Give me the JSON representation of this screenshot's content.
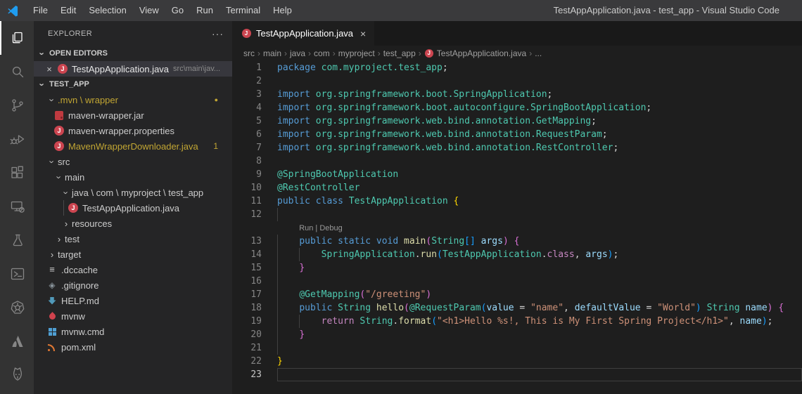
{
  "window": {
    "title": "TestAppApplication.java - test_app - Visual Studio Code",
    "menus": [
      "File",
      "Edit",
      "Selection",
      "View",
      "Go",
      "Run",
      "Terminal",
      "Help"
    ]
  },
  "activity_bar": {
    "items": [
      {
        "name": "explorer",
        "active": true
      },
      {
        "name": "search",
        "active": false
      },
      {
        "name": "source-control",
        "active": false
      },
      {
        "name": "run-and-debug",
        "active": false
      },
      {
        "name": "extensions",
        "active": false
      },
      {
        "name": "remote-explorer",
        "active": false
      },
      {
        "name": "testing",
        "active": false
      },
      {
        "name": "powershell",
        "active": false
      },
      {
        "name": "kubernetes",
        "active": false
      },
      {
        "name": "atlassian",
        "active": false
      },
      {
        "name": "snyk",
        "active": false
      }
    ]
  },
  "sidebar": {
    "title": "EXPLORER",
    "more_label": "···",
    "open_editors": {
      "label": "OPEN EDITORS",
      "items": [
        {
          "label": "TestAppApplication.java",
          "path": "src\\main\\jav...",
          "icon": "java",
          "close_glyph": "×",
          "selected": true
        }
      ]
    },
    "tree": {
      "label": "TEST_APP",
      "items": [
        {
          "label": ".mvn \\ wrapper",
          "indent": 1,
          "chevron": "down",
          "warn": true,
          "dot": "●"
        },
        {
          "label": "maven-wrapper.jar",
          "indent": 2,
          "icon": "jar"
        },
        {
          "label": "maven-wrapper.properties",
          "indent": 2,
          "icon": "java"
        },
        {
          "label": "MavenWrapperDownloader.java",
          "indent": 2,
          "icon": "java",
          "warn": true,
          "badge": "1"
        },
        {
          "label": "src",
          "indent": 1,
          "chevron": "down"
        },
        {
          "label": "main",
          "indent": 2,
          "chevron": "down"
        },
        {
          "label": "java \\ com \\ myproject \\ test_app",
          "indent": 3,
          "chevron": "down"
        },
        {
          "label": "TestAppApplication.java",
          "indent": 4,
          "icon": "java",
          "guide": true
        },
        {
          "label": "resources",
          "indent": 3,
          "chevron": "right"
        },
        {
          "label": "test",
          "indent": 2,
          "chevron": "right"
        },
        {
          "label": "target",
          "indent": 1,
          "chevron": "right"
        },
        {
          "label": ".dccache",
          "indent": 1,
          "icon": "dccache"
        },
        {
          "label": ".gitignore",
          "indent": 1,
          "icon": "git"
        },
        {
          "label": "HELP.md",
          "indent": 1,
          "icon": "md"
        },
        {
          "label": "mvnw",
          "indent": 1,
          "icon": "mvnw"
        },
        {
          "label": "mvnw.cmd",
          "indent": 1,
          "icon": "cmd"
        },
        {
          "label": "pom.xml",
          "indent": 1,
          "icon": "xml"
        }
      ]
    }
  },
  "editor": {
    "tab": {
      "label": "TestAppApplication.java",
      "icon": "java",
      "close_glyph": "×"
    },
    "breadcrumbs": [
      {
        "label": "src"
      },
      {
        "label": "main"
      },
      {
        "label": "java"
      },
      {
        "label": "com"
      },
      {
        "label": "myproject"
      },
      {
        "label": "test_app"
      },
      {
        "label": "TestAppApplication.java",
        "icon": "java"
      },
      {
        "label": "..."
      }
    ],
    "code": {
      "lines": [
        {
          "n": 1,
          "indent": 0,
          "guides": [],
          "tokens": [
            [
              "kw",
              "package"
            ],
            [
              "pl",
              " "
            ],
            [
              "ty",
              "com.myproject.test_app"
            ],
            [
              "pl",
              ";"
            ]
          ]
        },
        {
          "n": 2,
          "indent": 0,
          "guides": [],
          "tokens": []
        },
        {
          "n": 3,
          "indent": 0,
          "guides": [],
          "tokens": [
            [
              "kw",
              "import"
            ],
            [
              "pl",
              " "
            ],
            [
              "ty",
              "org.springframework.boot.SpringApplication"
            ],
            [
              "pl",
              ";"
            ]
          ]
        },
        {
          "n": 4,
          "indent": 0,
          "guides": [],
          "tokens": [
            [
              "kw",
              "import"
            ],
            [
              "pl",
              " "
            ],
            [
              "ty",
              "org.springframework.boot.autoconfigure.SpringBootApplication"
            ],
            [
              "pl",
              ";"
            ]
          ]
        },
        {
          "n": 5,
          "indent": 0,
          "guides": [],
          "tokens": [
            [
              "kw",
              "import"
            ],
            [
              "pl",
              " "
            ],
            [
              "ty",
              "org.springframework.web.bind.annotation.GetMapping"
            ],
            [
              "pl",
              ";"
            ]
          ]
        },
        {
          "n": 6,
          "indent": 0,
          "guides": [],
          "tokens": [
            [
              "kw",
              "import"
            ],
            [
              "pl",
              " "
            ],
            [
              "ty",
              "org.springframework.web.bind.annotation.RequestParam"
            ],
            [
              "pl",
              ";"
            ]
          ]
        },
        {
          "n": 7,
          "indent": 0,
          "guides": [],
          "tokens": [
            [
              "kw",
              "import"
            ],
            [
              "pl",
              " "
            ],
            [
              "ty",
              "org.springframework.web.bind.annotation.RestController"
            ],
            [
              "pl",
              ";"
            ]
          ]
        },
        {
          "n": 8,
          "indent": 0,
          "guides": [],
          "tokens": []
        },
        {
          "n": 9,
          "indent": 0,
          "guides": [],
          "tokens": [
            [
              "ty",
              "@SpringBootApplication"
            ]
          ]
        },
        {
          "n": 10,
          "indent": 0,
          "guides": [],
          "tokens": [
            [
              "ty",
              "@RestController"
            ]
          ]
        },
        {
          "n": 11,
          "indent": 0,
          "guides": [],
          "tokens": [
            [
              "kw",
              "public"
            ],
            [
              "pl",
              " "
            ],
            [
              "kw",
              "class"
            ],
            [
              "pl",
              " "
            ],
            [
              "ty",
              "TestAppApplication"
            ],
            [
              "pl",
              " "
            ],
            [
              "b1",
              "{"
            ]
          ]
        },
        {
          "n": 12,
          "indent": 0,
          "guides": [
            0
          ],
          "tokens": []
        },
        {
          "codelens": "Run | Debug",
          "indent": 4
        },
        {
          "n": 13,
          "indent": 4,
          "guides": [
            0
          ],
          "tokens": [
            [
              "kw",
              "public"
            ],
            [
              "pl",
              " "
            ],
            [
              "kw",
              "static"
            ],
            [
              "pl",
              " "
            ],
            [
              "kw",
              "void"
            ],
            [
              "pl",
              " "
            ],
            [
              "fn",
              "main"
            ],
            [
              "b2",
              "("
            ],
            [
              "ty",
              "String"
            ],
            [
              "b3",
              "[]"
            ],
            [
              "pl",
              " "
            ],
            [
              "va",
              "args"
            ],
            [
              "b2",
              ")"
            ],
            [
              "pl",
              " "
            ],
            [
              "b2",
              "{"
            ]
          ]
        },
        {
          "n": 14,
          "indent": 8,
          "guides": [
            0,
            4
          ],
          "tokens": [
            [
              "ty",
              "SpringApplication"
            ],
            [
              "pl",
              "."
            ],
            [
              "fn",
              "run"
            ],
            [
              "b3",
              "("
            ],
            [
              "ty",
              "TestAppApplication"
            ],
            [
              "pl",
              "."
            ],
            [
              "ct",
              "class"
            ],
            [
              "pl",
              ", "
            ],
            [
              "va",
              "args"
            ],
            [
              "b3",
              ")"
            ],
            [
              "pl",
              ";"
            ]
          ]
        },
        {
          "n": 15,
          "indent": 4,
          "guides": [
            0
          ],
          "tokens": [
            [
              "b2",
              "}"
            ]
          ]
        },
        {
          "n": 16,
          "indent": 0,
          "guides": [
            0
          ],
          "tokens": []
        },
        {
          "n": 17,
          "indent": 4,
          "guides": [
            0
          ],
          "tokens": [
            [
              "ty",
              "@GetMapping"
            ],
            [
              "b2",
              "("
            ],
            [
              "st",
              "\"/greeting\""
            ],
            [
              "b2",
              ")"
            ]
          ]
        },
        {
          "n": 18,
          "indent": 4,
          "guides": [
            0
          ],
          "tokens": [
            [
              "kw",
              "public"
            ],
            [
              "pl",
              " "
            ],
            [
              "ty",
              "String"
            ],
            [
              "pl",
              " "
            ],
            [
              "fn",
              "hello"
            ],
            [
              "b2",
              "("
            ],
            [
              "ty",
              "@RequestParam"
            ],
            [
              "b3",
              "("
            ],
            [
              "va",
              "value"
            ],
            [
              "pl",
              " = "
            ],
            [
              "st",
              "\"name\""
            ],
            [
              "pl",
              ", "
            ],
            [
              "va",
              "defaultValue"
            ],
            [
              "pl",
              " = "
            ],
            [
              "st",
              "\"World\""
            ],
            [
              "b3",
              ")"
            ],
            [
              "pl",
              " "
            ],
            [
              "ty",
              "String"
            ],
            [
              "pl",
              " "
            ],
            [
              "va",
              "name"
            ],
            [
              "b2",
              ")"
            ],
            [
              "pl",
              " "
            ],
            [
              "b2",
              "{"
            ]
          ]
        },
        {
          "n": 19,
          "indent": 8,
          "guides": [
            0,
            4
          ],
          "tokens": [
            [
              "ct",
              "return"
            ],
            [
              "pl",
              " "
            ],
            [
              "ty",
              "String"
            ],
            [
              "pl",
              "."
            ],
            [
              "fn",
              "format"
            ],
            [
              "b3",
              "("
            ],
            [
              "st",
              "\"<h1>Hello %s!, This is My First Spring Project</h1>\""
            ],
            [
              "pl",
              ", "
            ],
            [
              "va",
              "name"
            ],
            [
              "b3",
              ")"
            ],
            [
              "pl",
              ";"
            ]
          ]
        },
        {
          "n": 20,
          "indent": 4,
          "guides": [
            0
          ],
          "tokens": [
            [
              "b2",
              "}"
            ]
          ]
        },
        {
          "n": 21,
          "indent": 0,
          "guides": [
            0
          ],
          "tokens": []
        },
        {
          "n": 22,
          "indent": 0,
          "guides": [],
          "tokens": [
            [
              "b1",
              "}"
            ]
          ]
        },
        {
          "n": 23,
          "indent": 0,
          "guides": [],
          "current": true,
          "tokens": []
        }
      ]
    }
  },
  "colors": {
    "accent_blue": "#1f9cf0",
    "keyword": "#569cd6",
    "type": "#4ec9b0",
    "method": "#dcdcaa",
    "variable": "#9cdcfe",
    "string": "#ce9178",
    "control": "#c586c0",
    "bracket_gold": "#ffd700",
    "bracket_orchid": "#da70d6",
    "bracket_blue": "#179fff",
    "warning_yellow": "#c2a633",
    "java_icon_red": "#cc4550",
    "editor_bg": "#1e1e1e",
    "sidebar_bg": "#252526",
    "activitybar_bg": "#333333",
    "titlebar_bg": "#3a3a3c",
    "selection_bg": "#37373d"
  }
}
